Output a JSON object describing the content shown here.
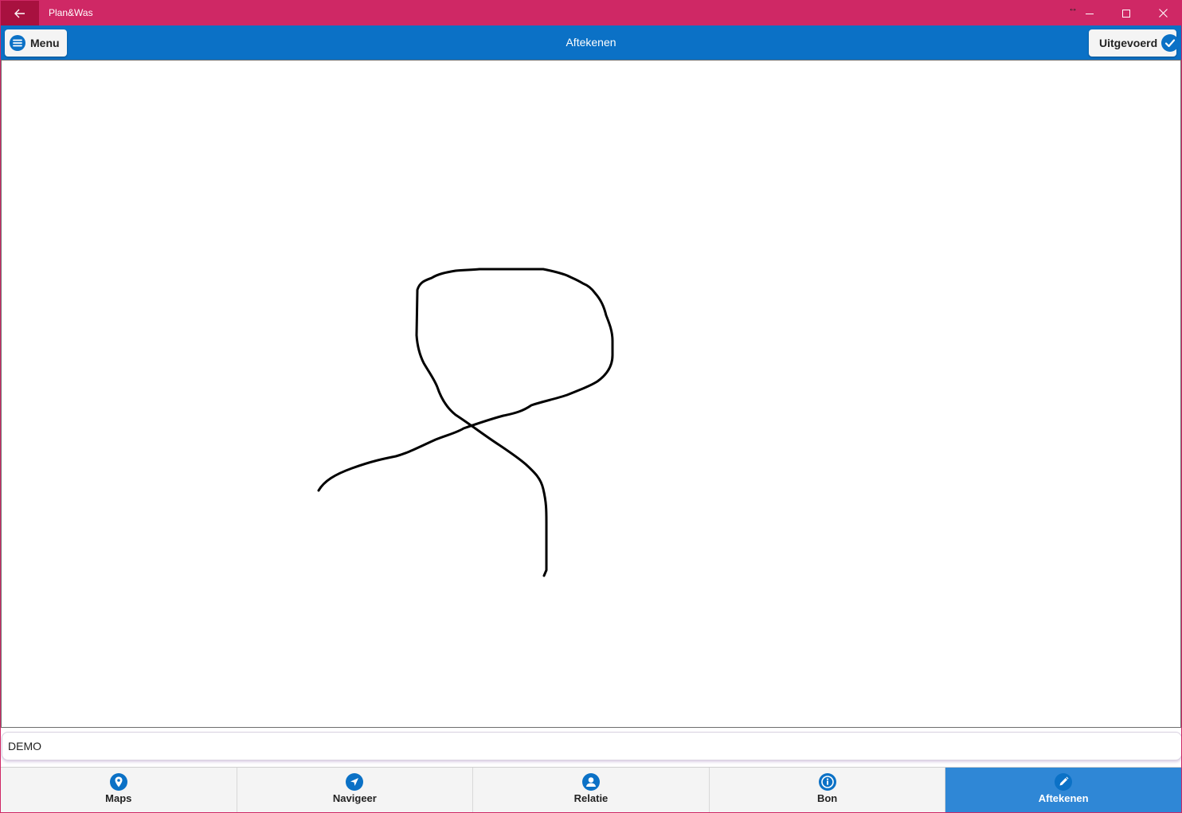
{
  "titlebar": {
    "app_title": "Plan&Was",
    "back_icon": "arrow-left-icon",
    "resize_hint": "↔"
  },
  "header": {
    "menu_label": "Menu",
    "page_title": "Aftekenen",
    "done_label": "Uitgevoerd"
  },
  "signature": {
    "stroke_color": "#000000"
  },
  "name_field": {
    "value": "DEMO"
  },
  "bottom_nav": {
    "items": [
      {
        "label": "Maps",
        "icon": "map-pin-icon"
      },
      {
        "label": "Navigeer",
        "icon": "navigate-icon"
      },
      {
        "label": "Relatie",
        "icon": "user-icon"
      },
      {
        "label": "Bon",
        "icon": "info-icon"
      },
      {
        "label": "Aftekenen",
        "icon": "pencil-icon",
        "active": true
      }
    ]
  },
  "colors": {
    "titlebar": "#cf2865",
    "header": "#0b71c6",
    "active_tab": "#2f87d6"
  }
}
